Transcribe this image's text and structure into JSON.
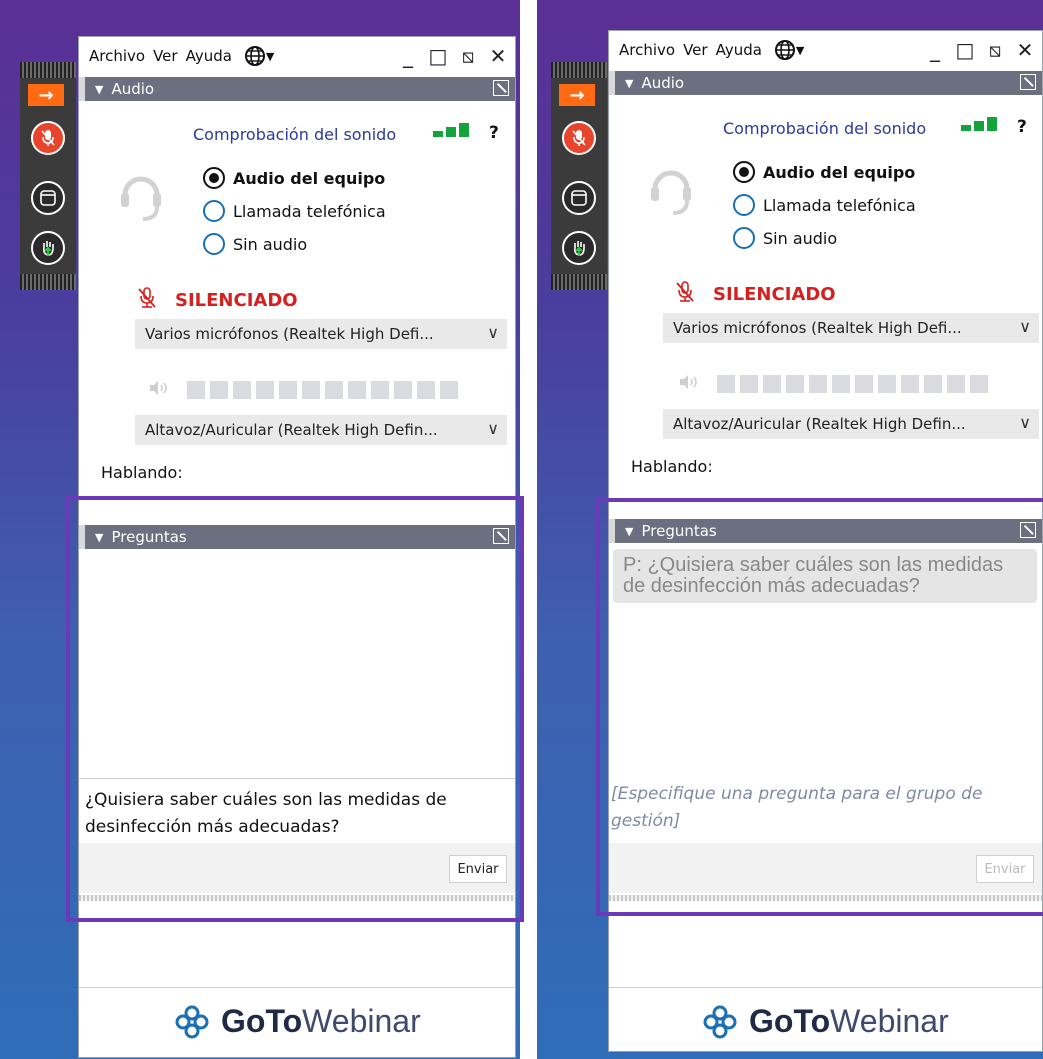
{
  "colors": {
    "accent_orange": "#ff6a13",
    "mic_red": "#e8452c",
    "muted_red": "#d61f1f",
    "section_header": "#6b6f80",
    "signal_green": "#14a33a",
    "highlight_purple": "#6a3ab8"
  },
  "menu": {
    "file": "Archivo",
    "view": "Ver",
    "help": "Ayuda"
  },
  "window_controls": {
    "minimize": "_",
    "restore": "□",
    "popout": "⧅",
    "close": "✕"
  },
  "audio": {
    "section_title": "Audio",
    "sound_check": "Comprobación del sonido",
    "help": "?",
    "options": {
      "computer": "Audio del equipo",
      "phone": "Llamada telefónica",
      "none": "Sin audio"
    },
    "selected_option": "Audio del equipo",
    "muted_label": "SILENCIADO",
    "microphone": "Varios micrófonos (Realtek High Defi...",
    "speaker": "Altavoz/Auricular (Realtek High Defin...",
    "talking_label": "Hablando:"
  },
  "questions": {
    "section_title": "Preguntas",
    "typed_question": "¿Quisiera saber cuáles son las medidas de desinfección más adecuadas?",
    "posted_question": "P: ¿Quisiera saber cuáles son las medidas de desinfección más adecuadas?",
    "placeholder": "[Especifique una pregunta para el grupo de gestión]",
    "send_label": "Enviar"
  },
  "brand": {
    "go": "Go",
    "to": "To",
    "webinar": "Webinar"
  }
}
